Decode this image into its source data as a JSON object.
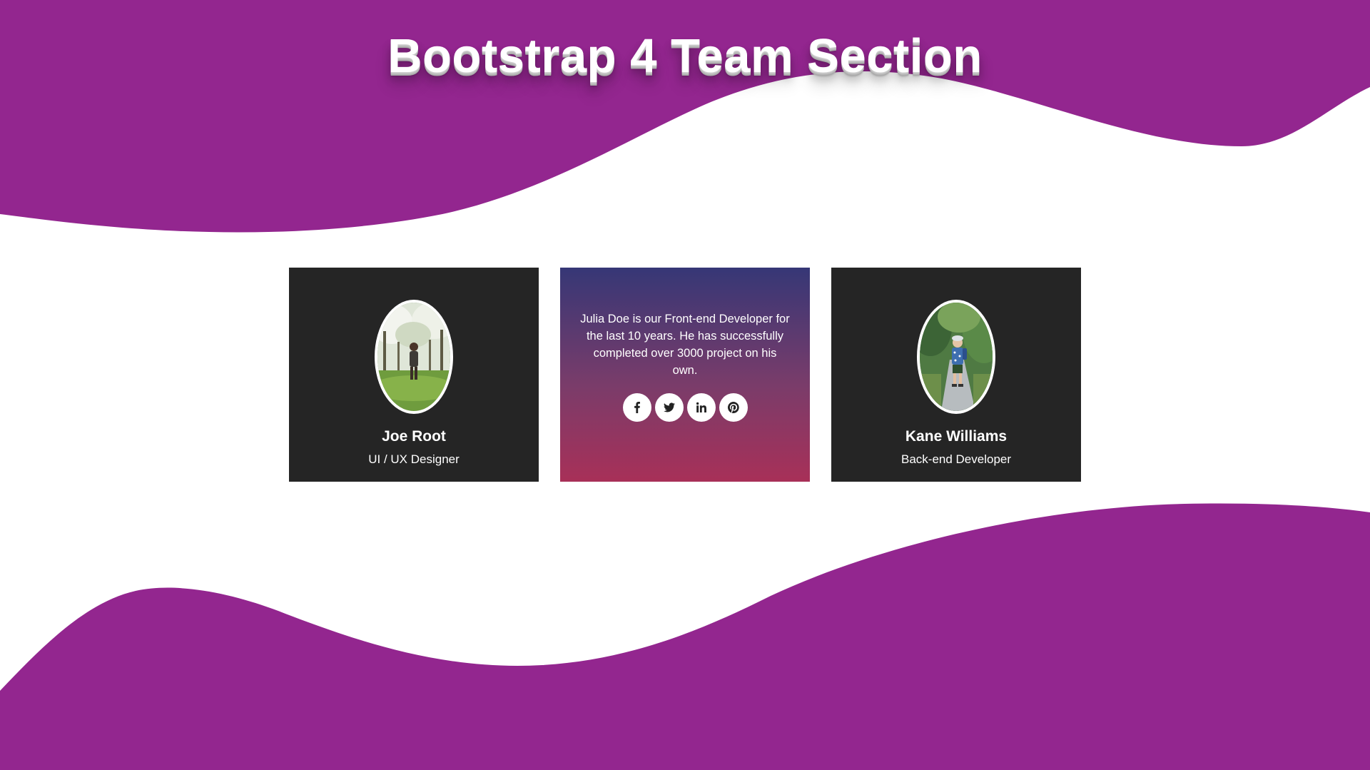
{
  "page": {
    "title": "Bootstrap 4 Team Section"
  },
  "colors": {
    "wave": "#93268F",
    "card_dark": "#252525",
    "gradient_top": "#363776",
    "gradient_bottom": "#A83058",
    "text": "#FFFFFF"
  },
  "team": {
    "members": [
      {
        "name": "Joe Root",
        "role": "UI / UX Designer",
        "photo": "child-in-blossom-garden-photo"
      },
      {
        "bio": "Julia Doe is our Front-end Developer for the last 10 years. He has successfully completed over 3000 project on his own.",
        "social": [
          "facebook-icon",
          "twitter-icon",
          "linkedin-icon",
          "pinterest-icon"
        ]
      },
      {
        "name": "Kane Williams",
        "role": "Back-end Developer",
        "photo": "child-with-backpack-photo"
      }
    ]
  }
}
